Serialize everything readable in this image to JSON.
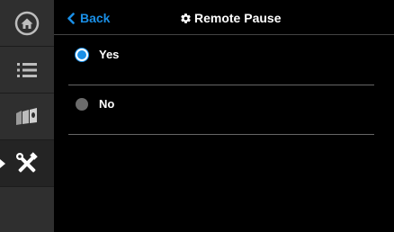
{
  "header": {
    "back_label": "Back",
    "title": "Remote Pause"
  },
  "options": [
    {
      "label": "Yes",
      "selected": true
    },
    {
      "label": "No",
      "selected": false
    }
  ],
  "sidebar": {
    "items": [
      {
        "icon": "home-icon"
      },
      {
        "icon": "list-icon"
      },
      {
        "icon": "filament-spools-icon"
      },
      {
        "icon": "tools-icon",
        "active": true
      },
      {
        "icon": "empty"
      }
    ]
  },
  "colors": {
    "accent": "#1a8fe6",
    "sidebar": "#2f2f2f",
    "background": "#000000"
  }
}
